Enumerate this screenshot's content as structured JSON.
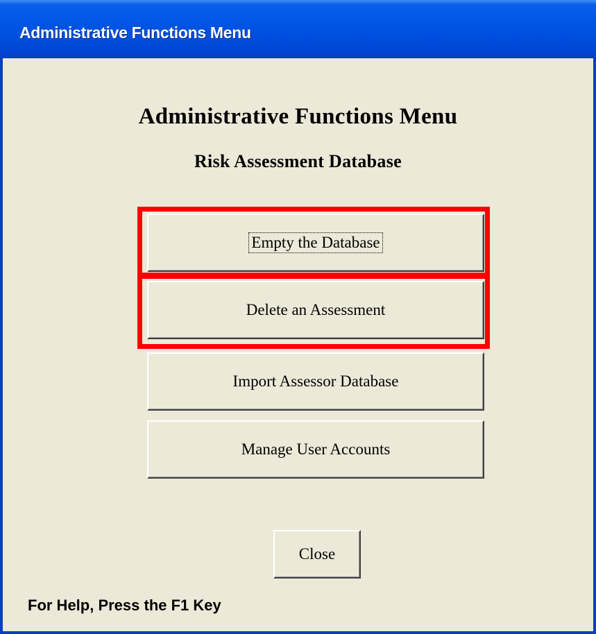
{
  "window": {
    "title": "Administrative Functions Menu"
  },
  "header": {
    "title": "Administrative Functions Menu",
    "subtitle": "Risk Assessment Database"
  },
  "menu": {
    "buttons": [
      {
        "label": "Empty the Database"
      },
      {
        "label": "Delete an Assessment"
      },
      {
        "label": "Import Assessor Database"
      },
      {
        "label": "Manage User Accounts"
      }
    ]
  },
  "footer": {
    "close_label": "Close",
    "status_text": "For Help, Press the F1 Key"
  },
  "colors": {
    "titlebar": "#0055e5",
    "window_bg": "#ece9d8",
    "highlight": "#ff0000"
  }
}
